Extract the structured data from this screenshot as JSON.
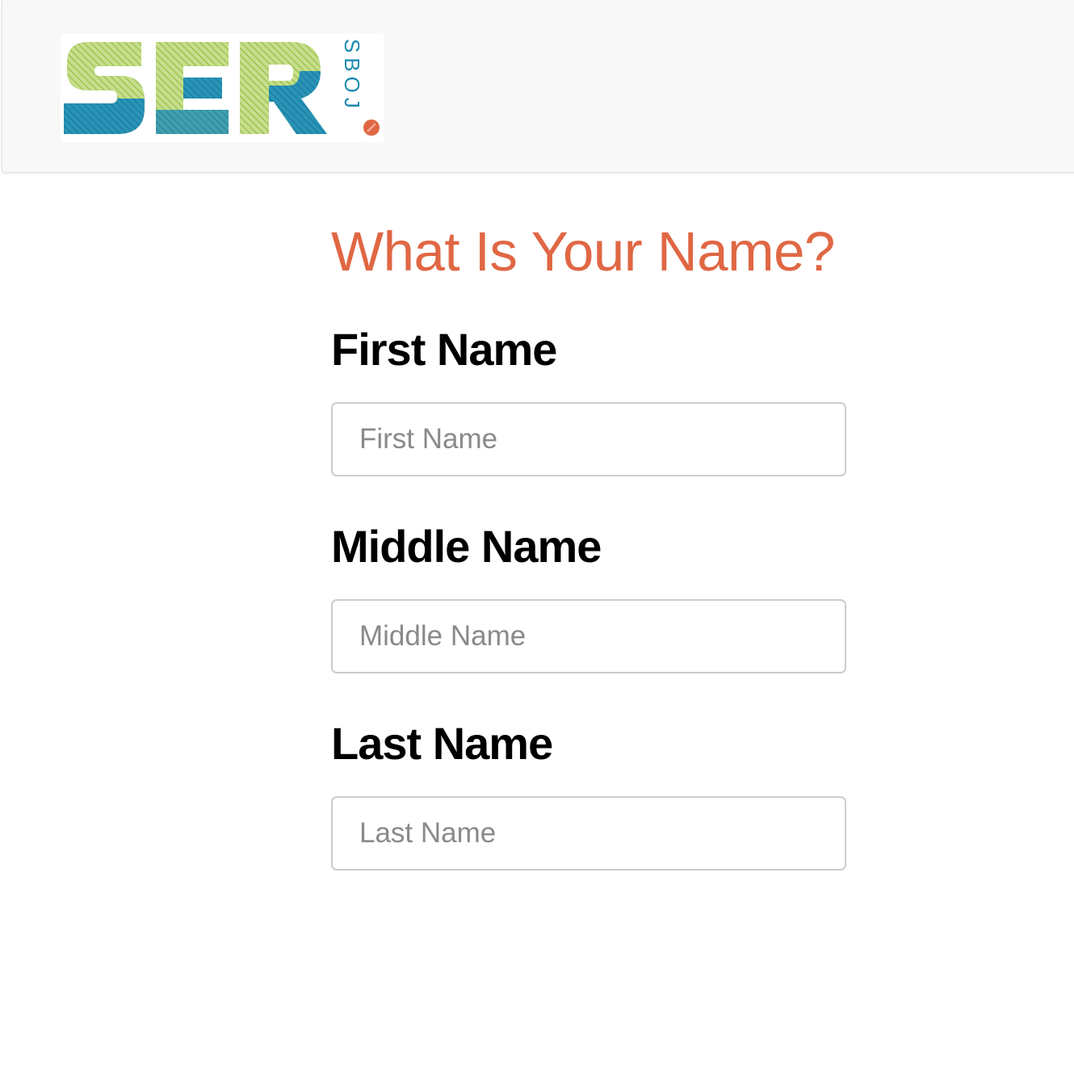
{
  "header": {
    "logo": {
      "wordmark": "SER",
      "subtext": "JOBS",
      "colors": {
        "blue": "#1d8ab0",
        "green": "#a9cc5b",
        "orange": "#e06744"
      }
    }
  },
  "form": {
    "title": "What Is Your Name?",
    "fields": [
      {
        "label": "First Name",
        "placeholder": "First Name",
        "value": ""
      },
      {
        "label": "Middle Name",
        "placeholder": "Middle Name",
        "value": ""
      },
      {
        "label": "Last Name",
        "placeholder": "Last Name",
        "value": ""
      }
    ]
  },
  "colors": {
    "title": "#e06744",
    "label": "#000000",
    "input_border": "#cccccc",
    "header_bg": "#f8f8f8"
  }
}
